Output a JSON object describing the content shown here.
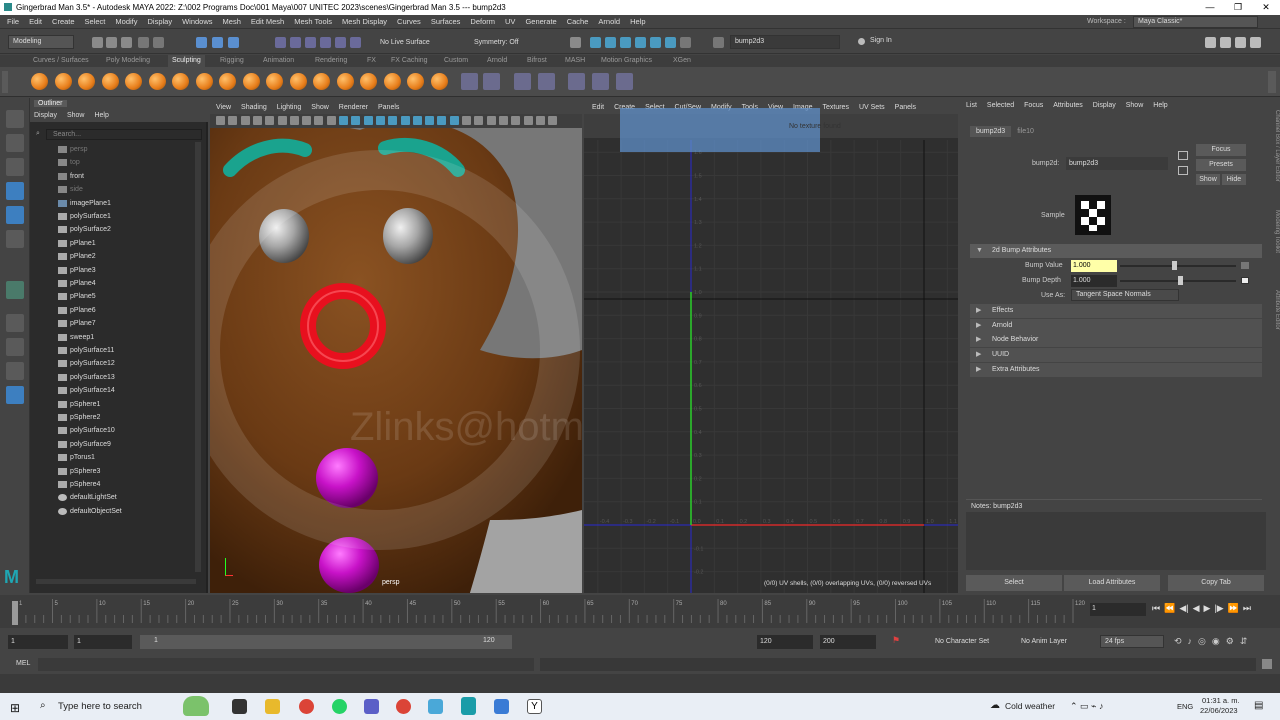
{
  "window": {
    "title": "Gingerbrad Man 3.5* - Autodesk MAYA 2022: Z:\\002 Programs Doc\\001 Maya\\007 UNITEC 2023\\scenes\\Gingerbrad Man 3.5   ---   bump2d3",
    "min": "—",
    "max": "❐",
    "close": "✕"
  },
  "menu": [
    "File",
    "Edit",
    "Create",
    "Select",
    "Modify",
    "Display",
    "Windows",
    "Mesh",
    "Edit Mesh",
    "Mesh Tools",
    "Mesh Display",
    "Curves",
    "Surfaces",
    "Deform",
    "UV",
    "Generate",
    "Cache",
    "Arnold",
    "Help"
  ],
  "workspace": {
    "label": "Workspace :",
    "value": "Maya Classic*"
  },
  "status": {
    "mode": "Modeling",
    "live_surface": "No Live Surface",
    "symmetry": "Symmetry: Off",
    "name_field": "bump2d3",
    "sign_in": "Sign In"
  },
  "shelf_tabs": [
    "Curves / Surfaces",
    "Poly Modeling",
    "Sculpting",
    "Rigging",
    "Animation",
    "Rendering",
    "FX",
    "FX Caching",
    "Custom",
    "Arnold",
    "Bifrost",
    "MASH",
    "Motion Graphics",
    "XGen"
  ],
  "shelf_active": "Sculpting",
  "outliner": {
    "title": "Outliner",
    "menu": [
      "Display",
      "Show",
      "Help"
    ],
    "search": "Search...",
    "items": [
      {
        "name": "persp",
        "dim": true,
        "kind": "camera"
      },
      {
        "name": "top",
        "dim": true,
        "kind": "camera"
      },
      {
        "name": "front",
        "dim": false,
        "kind": "camera"
      },
      {
        "name": "side",
        "dim": true,
        "kind": "camera"
      },
      {
        "name": "imagePlane1",
        "dim": false,
        "kind": "image"
      },
      {
        "name": "polySurface1",
        "dim": false,
        "kind": "mesh"
      },
      {
        "name": "polySurface2",
        "dim": false,
        "kind": "mesh"
      },
      {
        "name": "pPlane1",
        "dim": false,
        "kind": "mesh"
      },
      {
        "name": "pPlane2",
        "dim": false,
        "kind": "mesh"
      },
      {
        "name": "pPlane3",
        "dim": false,
        "kind": "mesh"
      },
      {
        "name": "pPlane4",
        "dim": false,
        "kind": "mesh"
      },
      {
        "name": "pPlane5",
        "dim": false,
        "kind": "mesh"
      },
      {
        "name": "pPlane6",
        "dim": false,
        "kind": "mesh"
      },
      {
        "name": "pPlane7",
        "dim": false,
        "kind": "mesh"
      },
      {
        "name": "sweep1",
        "dim": false,
        "kind": "mesh"
      },
      {
        "name": "polySurface11",
        "dim": false,
        "kind": "mesh"
      },
      {
        "name": "polySurface12",
        "dim": false,
        "kind": "mesh"
      },
      {
        "name": "polySurface13",
        "dim": false,
        "kind": "mesh"
      },
      {
        "name": "polySurface14",
        "dim": false,
        "kind": "mesh"
      },
      {
        "name": "pSphere1",
        "dim": false,
        "kind": "mesh"
      },
      {
        "name": "pSphere2",
        "dim": false,
        "kind": "mesh"
      },
      {
        "name": "polySurface10",
        "dim": false,
        "kind": "mesh"
      },
      {
        "name": "polySurface9",
        "dim": false,
        "kind": "mesh"
      },
      {
        "name": "pTorus1",
        "dim": false,
        "kind": "mesh"
      },
      {
        "name": "pSphere3",
        "dim": false,
        "kind": "mesh"
      },
      {
        "name": "pSphere4",
        "dim": false,
        "kind": "mesh"
      },
      {
        "name": "defaultLightSet",
        "dim": false,
        "kind": "set"
      },
      {
        "name": "defaultObjectSet",
        "dim": false,
        "kind": "set"
      }
    ]
  },
  "viewport": {
    "menu": [
      "View",
      "Shading",
      "Lighting",
      "Show",
      "Renderer",
      "Panels"
    ],
    "camera_label": "persp",
    "watermark": "Zlinks@hotmail.com"
  },
  "uv_editor": {
    "menu": [
      "Edit",
      "Create",
      "Select",
      "Cut/Sew",
      "Modify",
      "Tools",
      "View",
      "Image",
      "Textures",
      "UV Sets",
      "Panels"
    ],
    "no_texture": "No texture found",
    "status": "(0/0) UV shells, (0/0) overlapping UVs, (0/0) reversed UVs",
    "x_ticks": [
      "-0.4",
      "-0.3",
      "-0.2",
      "-0.1",
      "0.0",
      "0.1",
      "0.2",
      "0.3",
      "0.4",
      "0.5",
      "0.6",
      "0.7",
      "0.8",
      "0.9",
      "1.0",
      "1.1"
    ],
    "y_ticks": [
      "1.6",
      "1.5",
      "1.4",
      "1.3",
      "1.2",
      "1.1",
      "1.0",
      "0.9",
      "0.8",
      "0.7",
      "0.6",
      "0.5",
      "0.4",
      "0.3",
      "0.2",
      "0.1",
      "-0.1",
      "-0.2"
    ]
  },
  "attr": {
    "menu": [
      "List",
      "Selected",
      "Focus",
      "Attributes",
      "Display",
      "Show",
      "Help"
    ],
    "tabs": [
      "bump2d3",
      "file10"
    ],
    "node_label": "bump2d:",
    "node_value": "bump2d3",
    "focus": "Focus",
    "presets": "Presets",
    "show": "Show",
    "hide": "Hide",
    "sample": "Sample",
    "section": "2d Bump Attributes",
    "bump_value_label": "Bump Value",
    "bump_value": "1.000",
    "bump_value_level": 0.45,
    "bump_depth_label": "Bump Depth",
    "bump_depth": "1.000",
    "bump_depth_level": 0.5,
    "use_as_label": "Use As:",
    "use_as": "Tangent Space Normals",
    "sections": [
      "Effects",
      "Arnold",
      "Node Behavior",
      "UUID",
      "Extra Attributes"
    ],
    "notes": "Notes:  bump2d3",
    "buttons": [
      "Select",
      "Load Attributes",
      "Copy Tab"
    ],
    "side_tabs": [
      "Channel Box / Layer Editor",
      "Modeling Toolkit",
      "Attribute Editor"
    ]
  },
  "timeline": {
    "ticks": [
      "1",
      "5",
      "10",
      "15",
      "20",
      "25",
      "30",
      "35",
      "40",
      "45",
      "50",
      "55",
      "60",
      "65",
      "70",
      "75",
      "80",
      "85",
      "90",
      "95",
      "100",
      "105",
      "110",
      "115",
      "120"
    ],
    "current": "1",
    "range_start": "1",
    "range_inner_start": "1",
    "range_slider_start": "1",
    "range_slider_end": "120",
    "range_inner_end": "120",
    "range_end": "200",
    "char_set": "No Character Set",
    "anim_layer": "No Anim Layer",
    "fps": "24 fps"
  },
  "cmd": {
    "label": "MEL"
  },
  "taskbar": {
    "search": "Type here to search",
    "weather": "Cold weather",
    "lang": "ENG",
    "time": "01:31 a. m.",
    "date": "22/06/2023"
  }
}
